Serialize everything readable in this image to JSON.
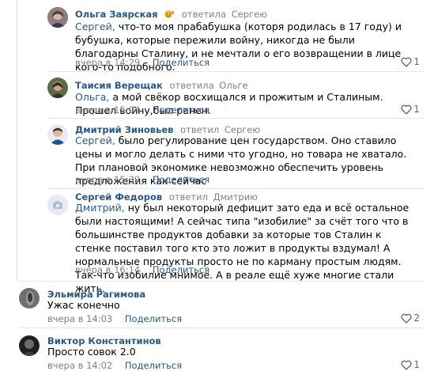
{
  "comments": [
    {
      "author": "Ольга Заярская",
      "badge_icon": "emoji-badge-icon",
      "reply_word": "ответила",
      "reply_to": "Сергею",
      "mention": "Сергей,",
      "text": " что-то моя прабабушка (которя родилась в 17 году) и бубушка, которые пережили войну, никогда не были благодарны Сталину, и не мечтали о его возвращении в лице кого-то подобного.",
      "time": "вчера в 14:29",
      "share": "Поделиться",
      "likes": "1"
    },
    {
      "author": "Таисия Верещак",
      "reply_word": "ответила",
      "reply_to": "Ольге",
      "mention": "Ольга,",
      "text": " а мой свёкор восхищался и прожитым и Сталиным. Прошел войну,был ранен.",
      "time": "вчера в 15:04",
      "share": "Поделиться",
      "likes": "1"
    },
    {
      "author": "Дмитрий Зиновьев",
      "reply_word": "ответил",
      "reply_to": "Сергею",
      "mention": "Сергей,",
      "text": " было регулирование цен государством. Оно ставило цены и могло делать с ними что угодно, но товара не хватало. При плановой экономике невозможно обеспечить уровень предложения как сейчас",
      "time": "вчера в 15:39",
      "share": "Поделиться",
      "likes": ""
    },
    {
      "author": "Сергей Федоров",
      "reply_word": "ответил",
      "reply_to": "Дмитрию",
      "mention": "Дмитрий,",
      "text": " ну был некоторый дефицит зато еда и всё остальное были настоящими! А сейчас типа \"изобилие\" за счёт того что в большинстве продуктов добавки за которые тов Сталин к стенке поставил того кто это ложит в продукты вздумал! А нормальные продукты просто не по карману простым людям. Так-что изобилие мнимое. А в реале ещё хуже многие стали жить.",
      "time": "вчера в 16:14",
      "share": "Поделиться",
      "likes": ""
    },
    {
      "author": "Эльмира Рагимова",
      "reply_word": "",
      "reply_to": "",
      "mention": "",
      "text": "Ужас конечно",
      "time": "вчера в 14:03",
      "share": "Поделиться",
      "likes": "2"
    },
    {
      "author": "Виктор Константинов",
      "reply_word": "",
      "reply_to": "",
      "mention": "",
      "text": "Просто совок 2.0",
      "time": "вчера в 14:02",
      "share": "Поделиться",
      "likes": "1"
    }
  ],
  "colors": {
    "link": "#2a5885",
    "muted": "#828282",
    "like_icon": "#5c6f87",
    "divider": "#e7e8ec"
  },
  "icons": {
    "like": "heart-outline-icon",
    "camera": "camera-placeholder-icon"
  }
}
